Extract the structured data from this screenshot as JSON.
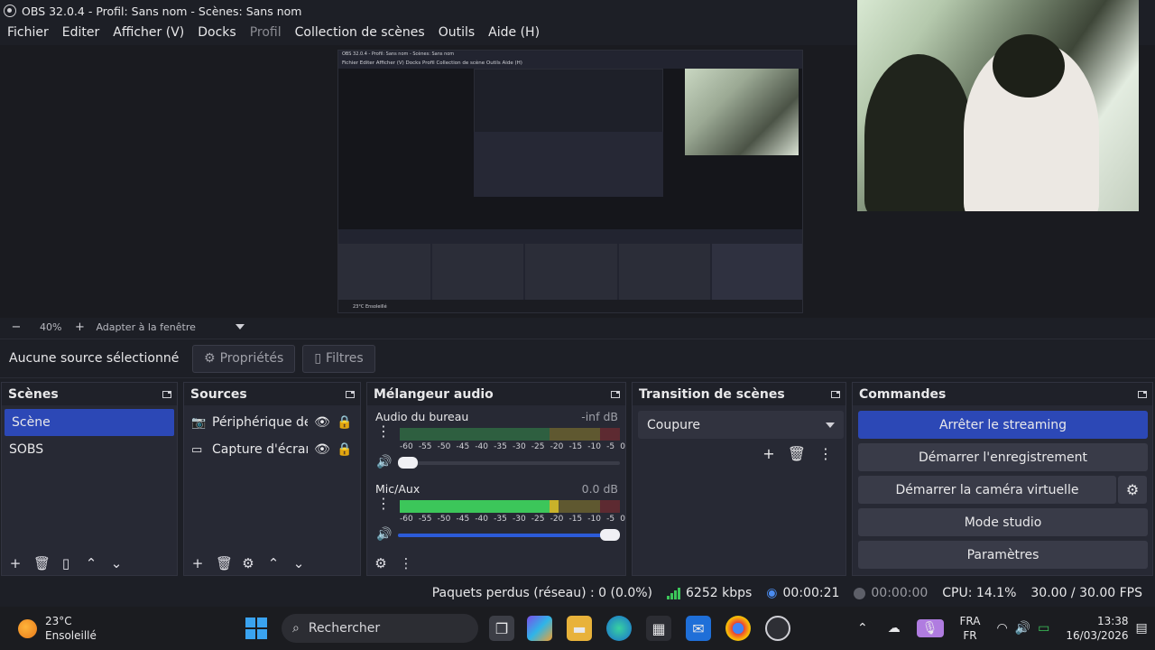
{
  "window": {
    "title": "OBS 32.0.4 - Profil: Sans nom - Scènes: Sans nom"
  },
  "menu": [
    {
      "label": "Fichier",
      "enabled": true
    },
    {
      "label": "Editer",
      "enabled": true
    },
    {
      "label": "Afficher (V)",
      "enabled": true
    },
    {
      "label": "Docks",
      "enabled": true
    },
    {
      "label": "Profil",
      "enabled": false
    },
    {
      "label": "Collection de scènes",
      "enabled": true
    },
    {
      "label": "Outils",
      "enabled": true
    },
    {
      "label": "Aide (H)",
      "enabled": true
    }
  ],
  "zoom": {
    "minus": "−",
    "value": "40%",
    "plus": "+",
    "fit": "Adapter à la fenêtre"
  },
  "source_bar": {
    "none_selected": "Aucune source sélectionné",
    "properties": "Propriétés",
    "filters": "Filtres"
  },
  "scenes": {
    "title": "Scènes",
    "items": [
      "Scène",
      "SOBS"
    ],
    "selected": 0
  },
  "sources": {
    "title": "Sources",
    "items": [
      {
        "icon": "camera-icon",
        "name": "Périphérique de c"
      },
      {
        "icon": "monitor-icon",
        "name": "Capture d'écran"
      }
    ]
  },
  "mixer": {
    "title": "Mélangeur audio",
    "ticks": [
      "-60",
      "-55",
      "-50",
      "-45",
      "-40",
      "-35",
      "-30",
      "-25",
      "-20",
      "-15",
      "-10",
      "-5",
      "0"
    ],
    "channels": [
      {
        "name": "Audio du bureau",
        "db": "-inf dB",
        "volume": 0.03,
        "level": 0.0
      },
      {
        "name": "Mic/Aux",
        "db": "0.0 dB",
        "volume": 0.97,
        "level": 0.72
      }
    ]
  },
  "transition": {
    "title": "Transition de scènes",
    "selected": "Coupure"
  },
  "commands": {
    "title": "Commandes",
    "stop_streaming": "Arrêter le streaming",
    "start_recording": "Démarrer l'enregistrement",
    "start_virtual_cam": "Démarrer la caméra virtuelle",
    "studio_mode": "Mode studio",
    "settings": "Paramètres"
  },
  "status": {
    "dropped": "Paquets perdus (réseau) : 0 (0.0%)",
    "bitrate": "6252 kbps",
    "stream_time": "00:00:21",
    "rec_time": "00:00:00",
    "cpu": "CPU: 14.1%",
    "fps": "30.00 / 30.00 FPS"
  },
  "taskbar": {
    "temp": "23°C",
    "weather": "Ensoleillé",
    "search_placeholder": "Rechercher",
    "lang_top": "FRA",
    "lang_bottom": "FR",
    "time": "13:38",
    "date": "16/03/2026"
  },
  "nested_preview": {
    "title": "OBS 32.0.4 - Profil: Sans nom - Scènes: Sans nom",
    "menu": "Fichier   Editer   Afficher (V)   Docks   Profil   Collection de scène   Outils   Aide (H)",
    "task": "23°C Ensoleillé"
  },
  "colors": {
    "accent": "#2c48b6",
    "panel": "#272934",
    "meter_green": "#3cc65a",
    "meter_yellow": "#c9b22a",
    "meter_red": "#c42f2f"
  }
}
